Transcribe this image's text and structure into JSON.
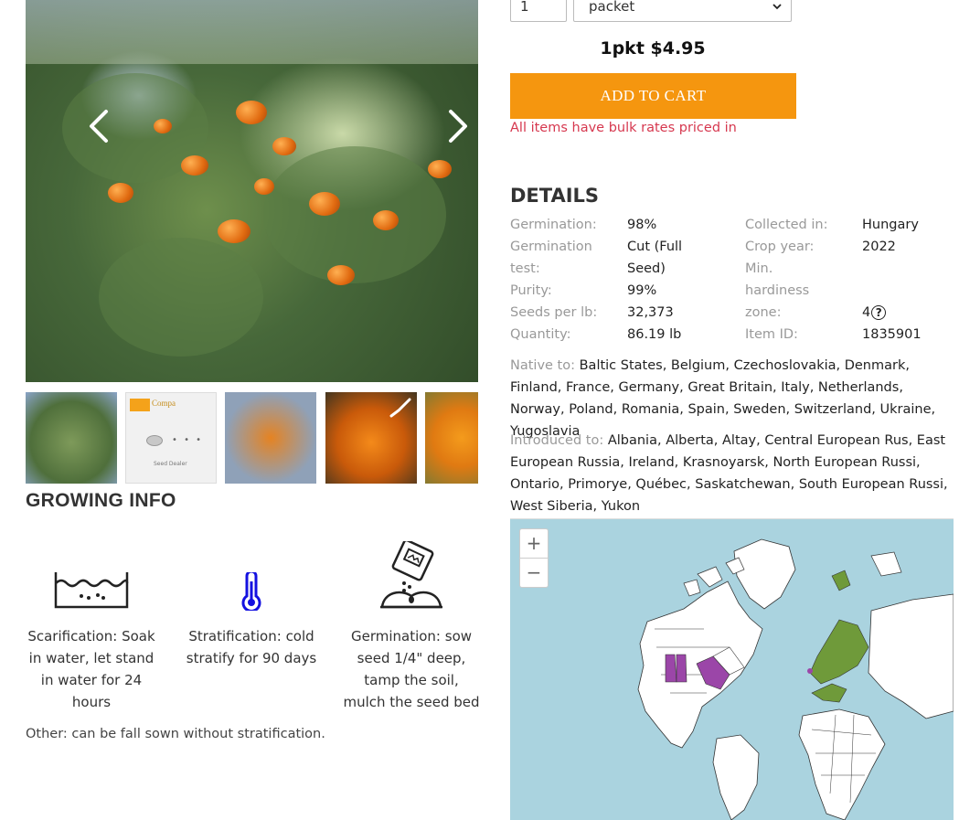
{
  "order": {
    "quantity": "1",
    "unit_selected": "packet",
    "price_text": "1pkt $4.95",
    "add_to_cart_label": "ADD TO CART",
    "bulk_note": "All items have bulk rates priced in"
  },
  "gallery": {
    "thumbnails": [
      {
        "icon": "sea-buckthorn-shrub"
      },
      {
        "icon": "seed-packet-logo",
        "logo_text": "Compa",
        "caption": "Seed Dealer"
      },
      {
        "icon": "orange-berries-branch"
      },
      {
        "icon": "berry-jar"
      },
      {
        "icon": "berry-cluster"
      }
    ]
  },
  "growing_info": {
    "title": "GROWING INFO",
    "steps": [
      {
        "icon": "water-soak-icon",
        "text": "Scarification: Soak in water, let stand in water for 24 hours"
      },
      {
        "icon": "thermometer-icon",
        "text": "Stratification: cold stratify for 90 days"
      },
      {
        "icon": "sow-seed-icon",
        "text": "Germination: sow seed 1/4\" deep, tamp the soil, mulch the seed bed"
      }
    ],
    "other": "Other: can be fall sown without stratification."
  },
  "details": {
    "title": "DETAILS",
    "left_labels": [
      "Germination:",
      "Germination",
      "test:",
      "Purity:",
      "Seeds per lb:",
      "Quantity:"
    ],
    "left_values": [
      "98%",
      "Cut (Full",
      "Seed)",
      "99%",
      "32,373",
      "86.19 lb"
    ],
    "right_labels": [
      "Collected in:",
      "Crop year:",
      "Min.",
      "hardiness",
      "zone:",
      "Item ID:"
    ],
    "right_values": [
      "Hungary",
      "2022",
      "",
      "",
      "4",
      "1835901"
    ],
    "native_label": "Native to:",
    "native_value": "Baltic States, Belgium, Czechoslovakia, Denmark, Finland, France, Germany, Great Britain, Italy, Netherlands, Norway, Poland, Romania, Spain, Sweden, Switzerland, Ukraine, Yugoslavia",
    "introduced_label": "Introduced to:",
    "introduced_value": "Albania, Alberta, Altay, Central European Rus, East European Russia, Ireland, Krasnoyarsk, North European Russi, Ontario, Primorye, Québec, Saskatchewan, South European Russi, West Siberia, Yukon"
  },
  "map": {
    "zoom_in": "+",
    "zoom_out": "−",
    "colors": {
      "water": "#aad3df",
      "land": "#ffffff",
      "native": "#6f9a3a",
      "introduced": "#9b46a8"
    }
  }
}
